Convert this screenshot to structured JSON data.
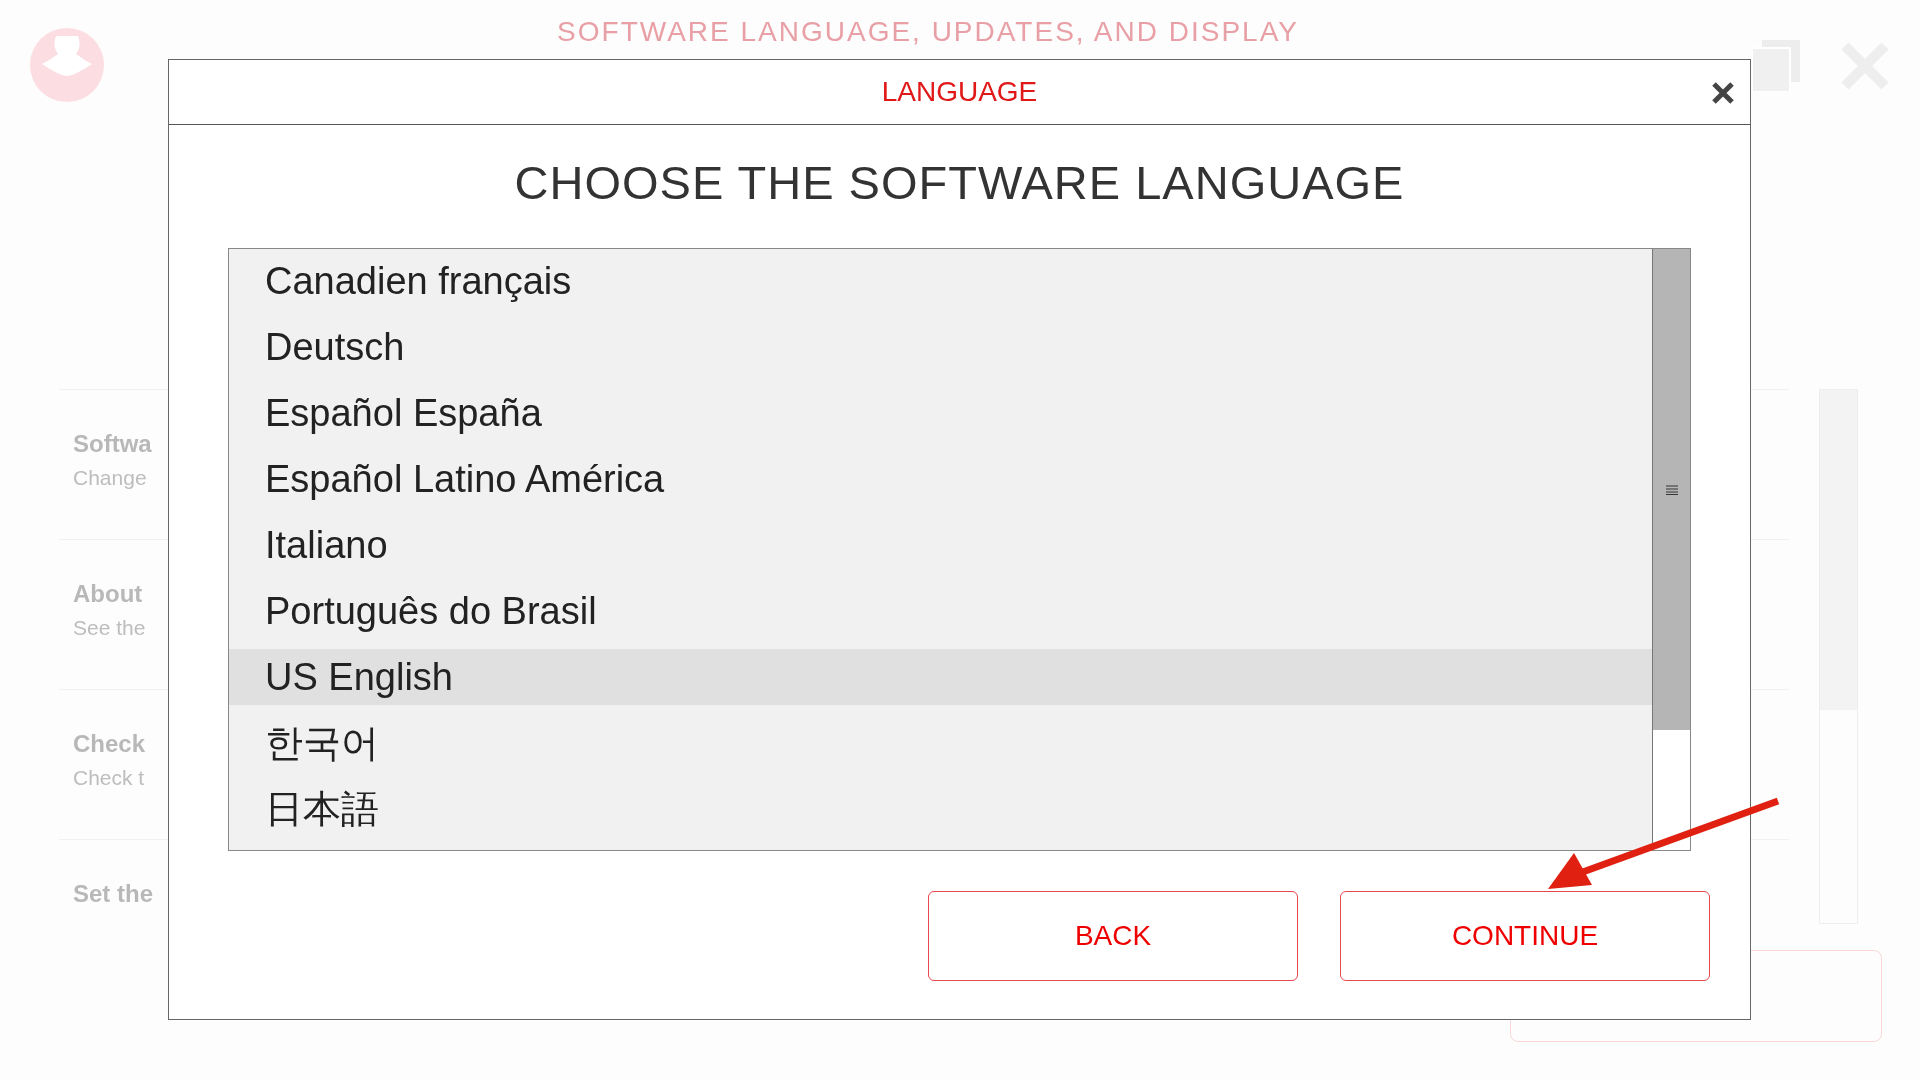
{
  "background": {
    "title": "SOFTWARE LANGUAGE, UPDATES, AND DISPLAY",
    "settings": [
      {
        "title": "Softwa",
        "subtitle": "Change"
      },
      {
        "title": "About",
        "subtitle": "See the"
      },
      {
        "title": "Check",
        "subtitle": "Check t"
      },
      {
        "title": "Set the"
      }
    ]
  },
  "dialog": {
    "title": "LANGUAGE",
    "heading": "CHOOSE THE SOFTWARE LANGUAGE",
    "languages": [
      {
        "label": "Canadien français",
        "selected": false
      },
      {
        "label": "Deutsch",
        "selected": false
      },
      {
        "label": "Español España",
        "selected": false
      },
      {
        "label": "Español Latino América",
        "selected": false
      },
      {
        "label": "Italiano",
        "selected": false
      },
      {
        "label": "Português do Brasil",
        "selected": false
      },
      {
        "label": "US English",
        "selected": true
      },
      {
        "label": "한국어",
        "selected": false
      },
      {
        "label": "日本語",
        "selected": false
      }
    ],
    "buttons": [
      {
        "label": "BACK"
      },
      {
        "label": "CONTINUE"
      }
    ]
  }
}
